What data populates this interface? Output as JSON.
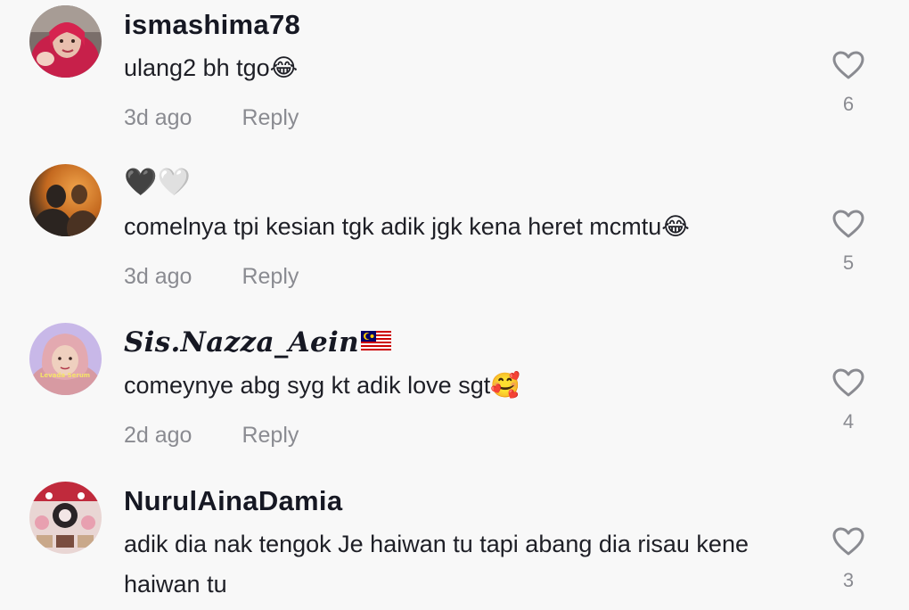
{
  "comments": [
    {
      "username": "ismashima78",
      "text": "ulang2 bh tgo😂",
      "time": "3d ago",
      "reply_label": "Reply",
      "likes": "6",
      "avatar_icon": "profile-photo-woman-hijab-red"
    },
    {
      "username": "🖤🤍",
      "text": "comelnya tpi kesian tgk adik jgk kena heret mcmtu😂",
      "time": "3d ago",
      "reply_label": "Reply",
      "likes": "5",
      "avatar_icon": "profile-photo-silhouettes-orange"
    },
    {
      "username": "𝑺𝒊𝒔.𝑵𝒂𝒛𝒛𝒂_𝑨𝒆𝒊𝒏",
      "username_flag": "malaysia-flag-icon",
      "text": "comeynye abg syg kt adik love sgt🥰",
      "time": "2d ago",
      "reply_label": "Reply",
      "likes": "4",
      "avatar_icon": "profile-photo-woman-hijab-pink",
      "avatar_caption": "Levada Serum"
    },
    {
      "username": "NurulAinaDamia",
      "text": "adik dia nak tengok Je haiwan tu tapi abang dia risau kene haiwan tu",
      "time": "",
      "reply_label": "",
      "likes": "3",
      "avatar_icon": "profile-photo-collage-red"
    }
  ],
  "colors": {
    "background": "#f8f8f8",
    "text": "#161823",
    "meta": "#8a8b91",
    "heart_outline": "#8a8b91"
  }
}
